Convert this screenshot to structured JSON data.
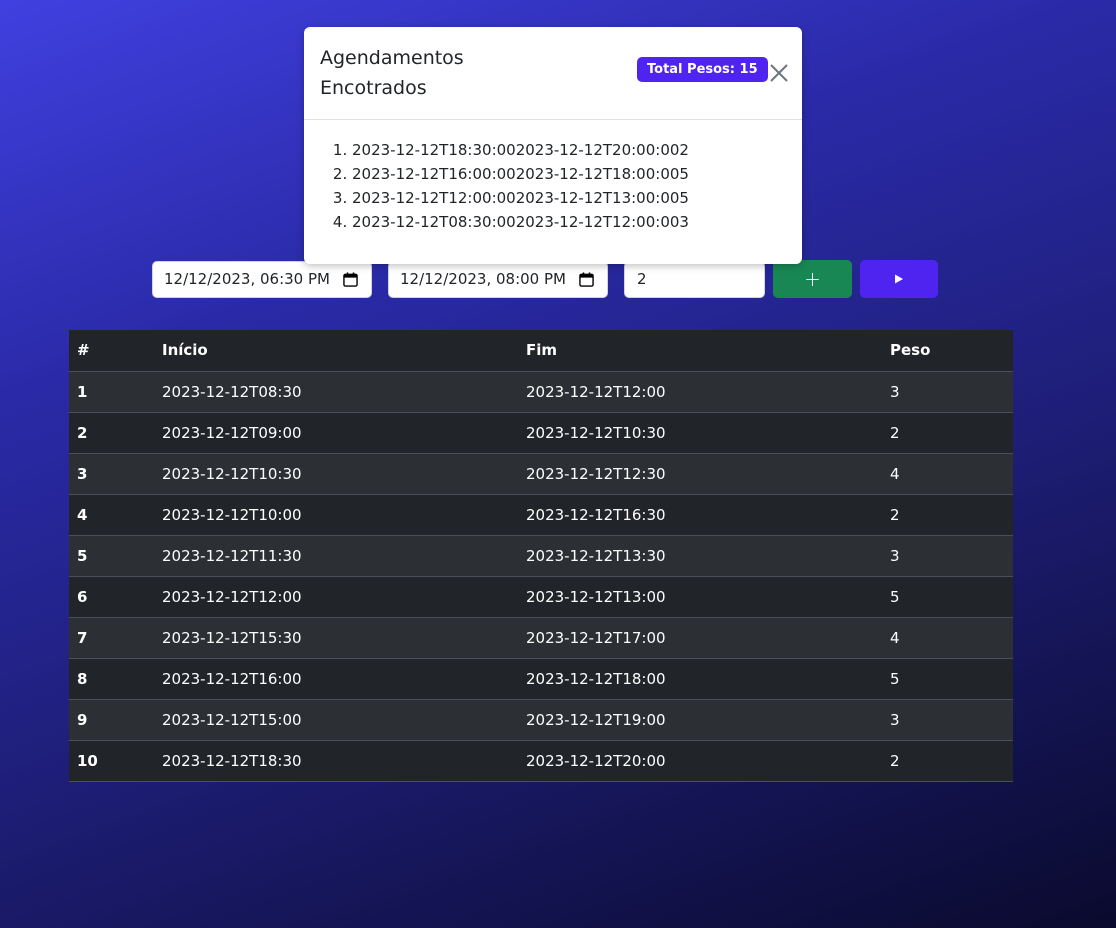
{
  "modal": {
    "title": "Agendamentos Encotrados",
    "badge": "Total Pesos: 15",
    "items": [
      "2023-12-12T18:30:002023-12-12T20:00:002",
      "2023-12-12T16:00:002023-12-12T18:00:005",
      "2023-12-12T12:00:002023-12-12T13:00:005",
      "2023-12-12T08:30:002023-12-12T12:00:003"
    ]
  },
  "form": {
    "start_value": "12/12/2023, 06:30 PM",
    "end_value": "12/12/2023, 08:00 PM",
    "weight_value": "2",
    "add_label": "+",
    "run_icon": "play-icon"
  },
  "table": {
    "headers": [
      "#",
      "Início",
      "Fim",
      "Peso"
    ],
    "rows": [
      [
        "1",
        "2023-12-12T08:30",
        "2023-12-12T12:00",
        "3"
      ],
      [
        "2",
        "2023-12-12T09:00",
        "2023-12-12T10:30",
        "2"
      ],
      [
        "3",
        "2023-12-12T10:30",
        "2023-12-12T12:30",
        "4"
      ],
      [
        "4",
        "2023-12-12T10:00",
        "2023-12-12T16:30",
        "2"
      ],
      [
        "5",
        "2023-12-12T11:30",
        "2023-12-12T13:30",
        "3"
      ],
      [
        "6",
        "2023-12-12T12:00",
        "2023-12-12T13:00",
        "5"
      ],
      [
        "7",
        "2023-12-12T15:30",
        "2023-12-12T17:00",
        "4"
      ],
      [
        "8",
        "2023-12-12T16:00",
        "2023-12-12T18:00",
        "5"
      ],
      [
        "9",
        "2023-12-12T15:00",
        "2023-12-12T19:00",
        "3"
      ],
      [
        "10",
        "2023-12-12T18:30",
        "2023-12-12T20:00",
        "2"
      ]
    ]
  },
  "colors": {
    "primary": "#4f24f0",
    "success": "#198754",
    "table_dark": "#212529",
    "table_stripe": "#2c3034"
  }
}
